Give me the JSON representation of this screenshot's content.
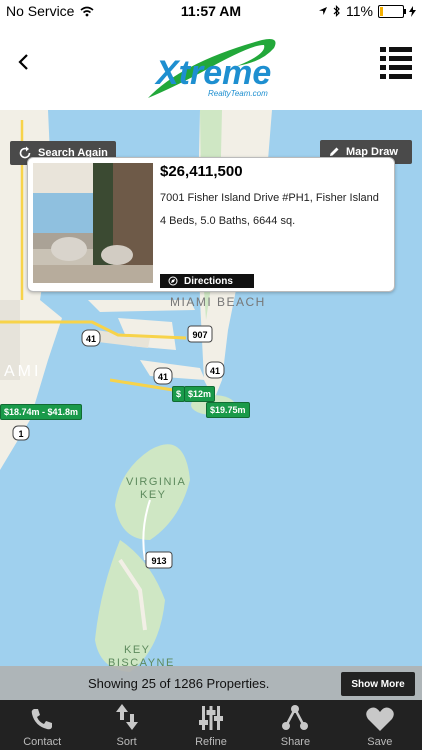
{
  "status": {
    "carrier": "No Service",
    "time": "11:57 AM",
    "battery": "11%",
    "battery_level": 0.11
  },
  "header": {
    "logo_word": "Xtreme",
    "logo_sub": "RealtyTeam.com"
  },
  "map": {
    "search_again_label": "Search Again",
    "map_draw_label": "Map Draw",
    "labels": {
      "miami_beach": "MIAMI BEACH",
      "miami": "AMI",
      "virginia_key_1": "VIRGINIA",
      "virginia_key_2": "KEY",
      "key_biscayne_1": "KEY",
      "key_biscayne_2": "BISCAYNE",
      "shield_907": "907",
      "shield_41a": "41",
      "shield_41b": "41",
      "shield_41c": "41",
      "shield_1": "1",
      "shield_913": "913"
    },
    "pins": [
      "$18.74m - $41.8m",
      "$12m",
      "$19.75m",
      "$"
    ]
  },
  "popup": {
    "price": "$26,411,500",
    "address": "7001 Fisher Island Drive #PH1, Fisher Island",
    "details": "4 Beds, 5.0 Baths, 6644 sq.",
    "directions_label": "Directions"
  },
  "footer": {
    "showing_text": "Showing 25 of 1286 Properties.",
    "show_more_label": "Show More"
  },
  "tabs": [
    {
      "label": "Contact",
      "icon": "phone-icon"
    },
    {
      "label": "Sort",
      "icon": "sort-icon"
    },
    {
      "label": "Refine",
      "icon": "sliders-icon"
    },
    {
      "label": "Share",
      "icon": "share-icon"
    },
    {
      "label": "Save",
      "icon": "heart-icon"
    }
  ],
  "colors": {
    "accent_green": "#1a9a4a",
    "logo_blue": "#1e8fd0",
    "water": "#9fd0ee",
    "land": "#f2efe6"
  }
}
